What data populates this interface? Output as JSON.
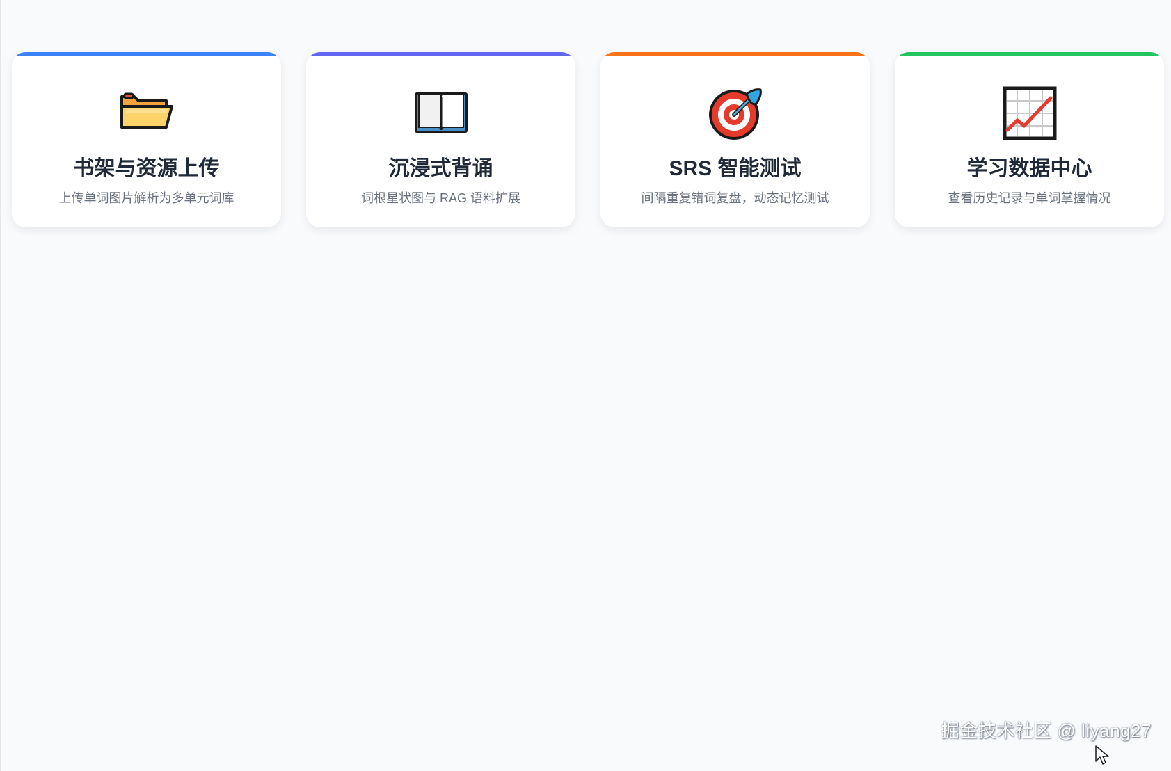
{
  "cards": [
    {
      "title": "书架与资源上传",
      "description": "上传单词图片解析为多单元词库",
      "icon": "folder-icon",
      "accent_color": "#3b82f6"
    },
    {
      "title": "沉浸式背诵",
      "description": "词根星状图与 RAG 语料扩展",
      "icon": "open-book-icon",
      "accent_color": "#6366f1"
    },
    {
      "title": "SRS 智能测试",
      "description": "间隔重复错词复盘，动态记忆测试",
      "icon": "target-icon",
      "accent_color": "#f97316"
    },
    {
      "title": "学习数据中心",
      "description": "查看历史记录与单词掌握情况",
      "icon": "chart-increasing-icon",
      "accent_color": "#22c55e"
    }
  ],
  "watermark": {
    "text": "掘金技术社区 @ liyang27"
  }
}
